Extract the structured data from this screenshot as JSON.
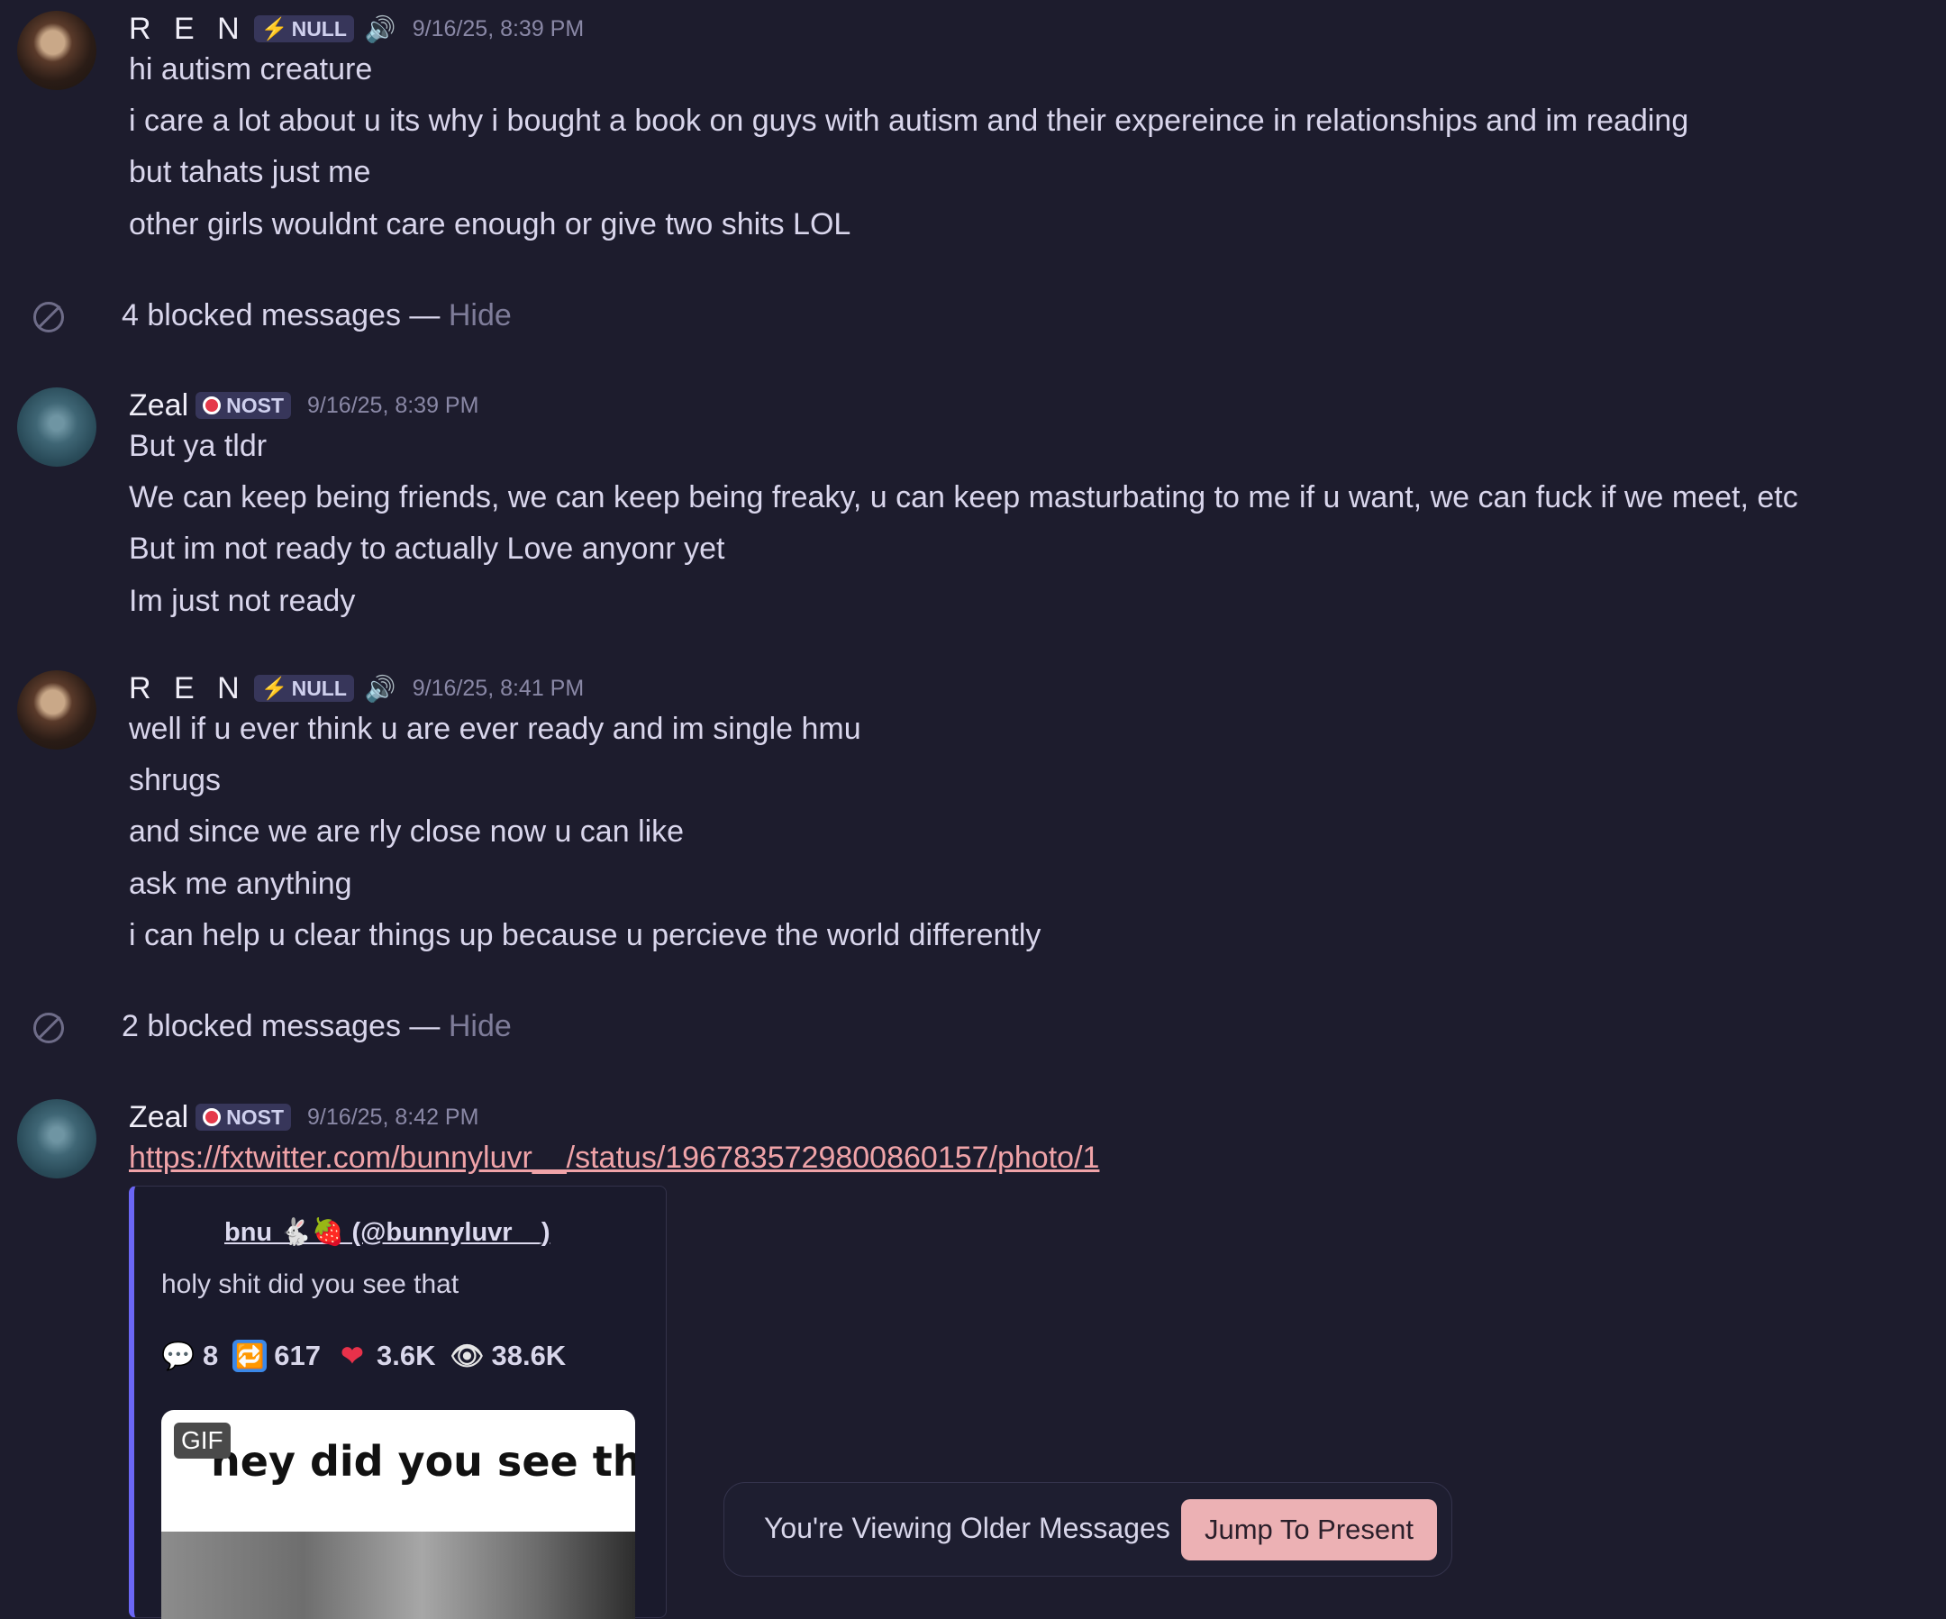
{
  "groups": [
    {
      "username": "R E N",
      "tag": "NULL",
      "timestamp": "9/16/25, 8:39 PM",
      "lines": [
        "hi autism creature",
        "i care a lot about u its why i bought a book on guys with autism and their expereince in relationships and im reading",
        "but tahats just me",
        "other girls wouldnt care enough or give two shits LOL"
      ]
    },
    {
      "username": "Zeal",
      "tag": "NOST",
      "timestamp": "9/16/25, 8:39 PM",
      "lines": [
        "But ya tldr",
        "We can keep being friends, we can keep being freaky, u can keep masturbating to me if u want, we can fuck if we meet, etc",
        "But im not ready to actually Love anyonr yet",
        "Im just not ready"
      ]
    },
    {
      "username": "R E N",
      "tag": "NULL",
      "timestamp": "9/16/25, 8:41 PM",
      "lines": [
        "well if u ever think u are ever ready and im single hmu",
        "shrugs",
        "and since we are rly close now u can like",
        "ask me anything",
        "i can help u clear things up because u percieve the world differently"
      ]
    },
    {
      "username": "Zeal",
      "tag": "NOST",
      "timestamp": "9/16/25, 8:42 PM",
      "link": "https://fxtwitter.com/bunnyluvr__/status/1967835729800860157/photo/1"
    }
  ],
  "blocked": [
    {
      "text": "4 blocked messages — ",
      "action": "Hide"
    },
    {
      "text": "2 blocked messages — ",
      "action": "Hide"
    }
  ],
  "embed": {
    "author": "bnu 🐇🍓 (@bunnyluvr__)",
    "description": "holy shit did you see that",
    "stats": {
      "comments": "8",
      "retweets": "617",
      "likes": "3.6K",
      "views": "38.6K"
    },
    "gif_badge": "GIF",
    "gif_caption": "hey did you see that"
  },
  "older_bar": {
    "text": "You're Viewing Older Messages",
    "button": "Jump To Present"
  },
  "icons": {
    "speaker": "speaker-icon",
    "blocked": "blocked-icon",
    "tag_null": "lightning-bolt-icon",
    "tag_nost": "red-ring-icon"
  },
  "colors": {
    "background": "#1d1c2d",
    "link": "#f0a3a8",
    "embed_accent": "#6b66f5",
    "jump_button": "#ecb1b4"
  }
}
